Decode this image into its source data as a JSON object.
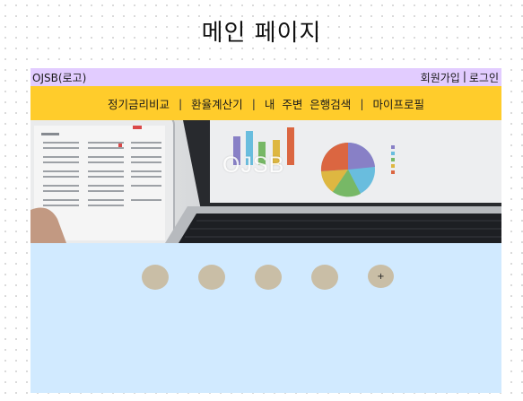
{
  "page_title": "메인 페이지",
  "top_bar": {
    "brand": "OJSB(로고)",
    "signup": "회원가입",
    "separator": "|",
    "login": "로그인"
  },
  "nav": {
    "items": [
      "정기금리비교",
      "환율계산기",
      "내  주변  은행검색",
      "마이프로필"
    ],
    "separator": "|"
  },
  "hero": {
    "overlay_text": "OJSB"
  },
  "circles": {
    "plus_label": "+"
  },
  "colors": {
    "top_bar": "#e2ccff",
    "nav": "#ffcc2b",
    "content": "#d1eaff",
    "circle": "#c9bea6"
  }
}
